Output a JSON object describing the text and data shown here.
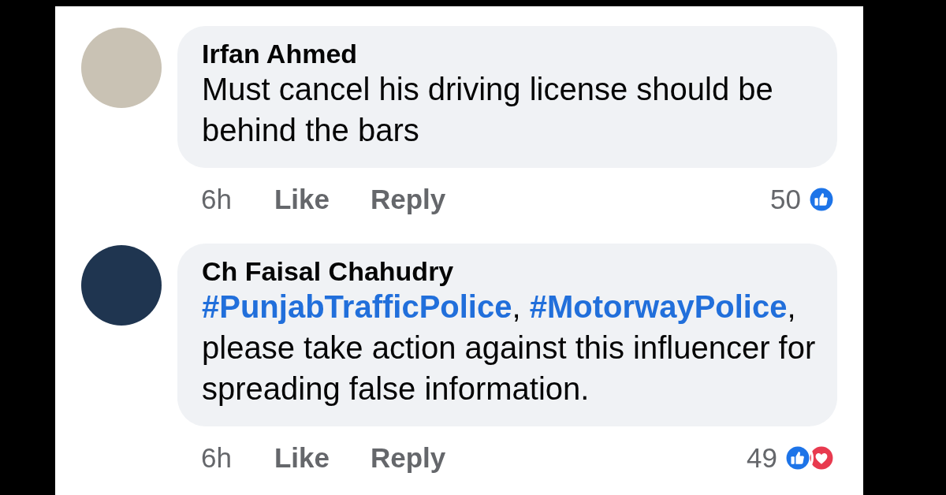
{
  "comments": [
    {
      "author": "Irfan Ahmed",
      "avatar": {
        "kind": "photo"
      },
      "body": [
        {
          "kind": "text",
          "text": "Must cancel his driving license should be behind the bars"
        }
      ],
      "time": "6h",
      "actions": [
        "Like",
        "Reply"
      ],
      "reaction_count": "50",
      "reactions": [
        {
          "kind": "like"
        }
      ]
    },
    {
      "author": "Ch Faisal Chahudry",
      "avatar": {
        "kind": "logo"
      },
      "body": [
        {
          "kind": "hashtag",
          "text": "#PunjabTrafficPolice"
        },
        {
          "kind": "text",
          "text": ", "
        },
        {
          "kind": "hashtag",
          "text": "#MotorwayPolice"
        },
        {
          "kind": "text",
          "text": ", please take action against this influencer for spreading false information."
        }
      ],
      "time": "6h",
      "actions": [
        "Like",
        "Reply"
      ],
      "reaction_count": "49",
      "reactions": [
        {
          "kind": "like"
        },
        {
          "kind": "love"
        }
      ]
    }
  ]
}
